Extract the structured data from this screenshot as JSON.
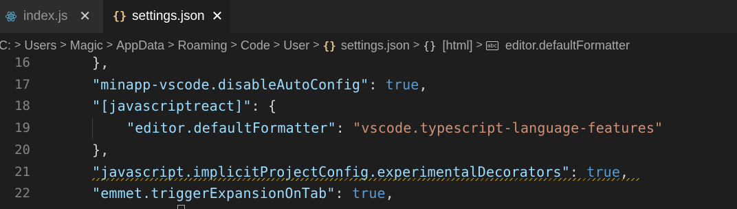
{
  "tabs": [
    {
      "label": "index.js",
      "icon": "react-icon",
      "active": false
    },
    {
      "label": "settings.json",
      "icon": "json-braces-icon",
      "active": true
    }
  ],
  "breadcrumb": {
    "items": [
      "C:",
      "Users",
      "Magic",
      "AppData",
      "Roaming",
      "Code",
      "User",
      "settings.json",
      "[html]",
      "editor.defaultFormatter"
    ],
    "icons": {
      "file": "json-braces-icon",
      "object": "object-braces-icon",
      "property": "string-abc-icon"
    }
  },
  "colors": {
    "background": "#1e1e1e",
    "key": "#9cdcfe",
    "string": "#ce9178",
    "keyword": "#569cd6",
    "line_number": "#858585",
    "warning": "#cca700"
  },
  "editor": {
    "lines": [
      {
        "num": "16",
        "text": "},"
      },
      {
        "num": "17",
        "key": "\"minapp-vscode.disableAutoConfig\"",
        "value": "true"
      },
      {
        "num": "18",
        "key": "\"[javascriptreact]\"",
        "open": "{"
      },
      {
        "num": "19",
        "key": "\"editor.defaultFormatter\"",
        "value": "\"vscode.typescript-language-features\""
      },
      {
        "num": "20",
        "text": "},"
      },
      {
        "num": "21",
        "key": "\"javascript.implicitProjectConfig.experimentalDecorators\"",
        "value": "true"
      },
      {
        "num": "22",
        "key": "\"emmet.triggerExpansionOnTab\"",
        "value": "true"
      }
    ]
  }
}
